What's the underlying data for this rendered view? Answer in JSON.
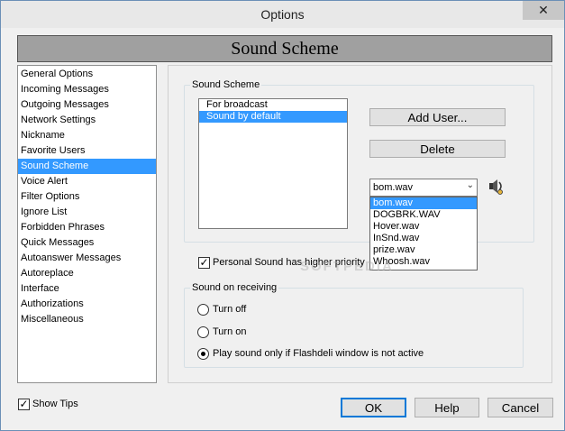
{
  "window": {
    "title": "Options",
    "close_glyph": "✕"
  },
  "banner": {
    "title": "Sound Scheme"
  },
  "nav": {
    "items": [
      "General Options",
      "Incoming Messages",
      "Outgoing Messages",
      "Network Settings",
      "Nickname",
      "Favorite Users",
      "Sound Scheme",
      "Voice Alert",
      "Filter Options",
      "Ignore List",
      "Forbidden Phrases",
      "Quick Messages",
      "Autoanswer Messages",
      "Autoreplace",
      "Interface",
      "Authorizations",
      "Miscellaneous"
    ],
    "selected_index": 6
  },
  "sound_scheme_group": {
    "label": "Sound Scheme",
    "list": {
      "items": [
        "For broadcast",
        "Sound by default"
      ],
      "selected_index": 1
    },
    "add_user_label": "Add User...",
    "delete_label": "Delete",
    "combo": {
      "value": "bom.wav",
      "options": [
        "bom.wav",
        "DOGBRK.WAV",
        "Hover.wav",
        "InSnd.wav",
        "prize.wav",
        "Whoosh.wav"
      ],
      "selected_index": 0,
      "arrow_icon": "chevron-down-icon"
    },
    "play_icon": "speaker-play-icon"
  },
  "personal_sound": {
    "label": "Personal Sound has higher priority",
    "checked": true
  },
  "receiving_group": {
    "label": "Sound on receiving",
    "options": [
      "Turn off",
      "Turn on",
      "Play sound only if Flashdeli window is not active"
    ],
    "selected_index": 2
  },
  "footer": {
    "show_tips": {
      "label": "Show Tips",
      "checked": true
    },
    "ok_label": "OK",
    "help_label": "Help",
    "cancel_label": "Cancel"
  },
  "watermark": "SOFTPEDIA",
  "colors": {
    "selection": "#3399ff",
    "banner": "#a0a0a0"
  }
}
